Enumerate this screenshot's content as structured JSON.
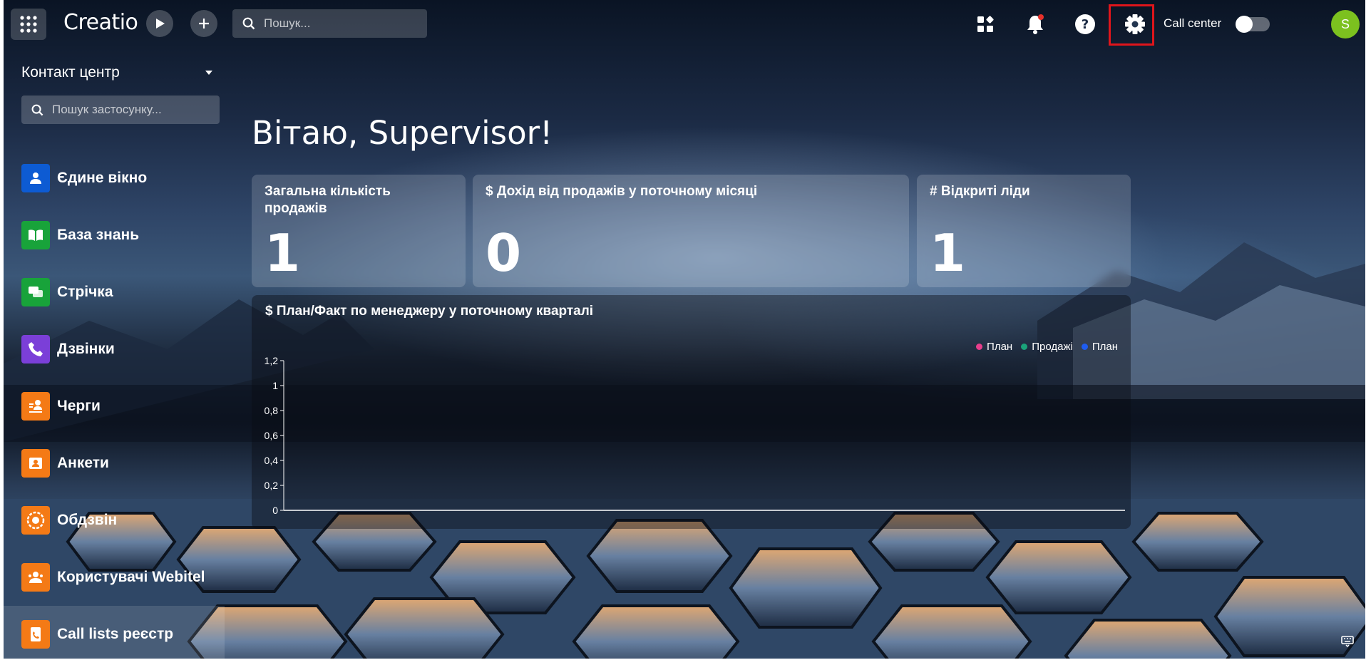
{
  "topbar": {
    "logo": "Creatio",
    "search_placeholder": "Пошук...",
    "call_center_label": "Call center",
    "avatar_initial": "S"
  },
  "sidebar": {
    "workspace_title": "Контакт центр",
    "app_search_placeholder": "Пошук застосунку...",
    "items": [
      {
        "label": "Єдине вікно",
        "icon": "user-window-icon",
        "color": "#0d5bd3"
      },
      {
        "label": "База знань",
        "icon": "book-icon",
        "color": "#18a33a"
      },
      {
        "label": "Стрічка",
        "icon": "chat-icon",
        "color": "#18a33a"
      },
      {
        "label": "Дзвінки",
        "icon": "phone-icon",
        "color": "#7b3fd8"
      },
      {
        "label": "Черги",
        "icon": "queue-icon",
        "color": "#f47a16"
      },
      {
        "label": "Анкети",
        "icon": "profile-card-icon",
        "color": "#f47a16"
      },
      {
        "label": "Обдзвін",
        "icon": "dial-icon",
        "color": "#f47a16"
      },
      {
        "label": "Користувачі Webitel",
        "icon": "users-icon",
        "color": "#f47a16"
      },
      {
        "label": "Call lists реєстр",
        "icon": "call-list-icon",
        "color": "#f47a16"
      }
    ]
  },
  "main": {
    "greeting": "Вітаю, Supervisor!",
    "kpis": [
      {
        "title": "Загальна кількість продажів",
        "value": "1"
      },
      {
        "title": "$ Дохід від продажів у поточному місяці",
        "value": "0"
      },
      {
        "title": "# Відкриті ліди",
        "value": "1"
      }
    ]
  },
  "chart_data": {
    "type": "bar",
    "title": "$ План/Факт по менеджеру у поточному кварталі",
    "categories": [],
    "series": [
      {
        "name": "План",
        "color": "#e83e8c",
        "values": []
      },
      {
        "name": "Продажі",
        "color": "#1aa37a",
        "values": []
      },
      {
        "name": "План",
        "color": "#1e5cf0",
        "values": []
      }
    ],
    "yticks": [
      "0",
      "0,2",
      "0,4",
      "0,6",
      "0,8",
      "1",
      "1,2"
    ],
    "ylim": [
      0,
      1.2
    ],
    "legend": "top-right"
  }
}
